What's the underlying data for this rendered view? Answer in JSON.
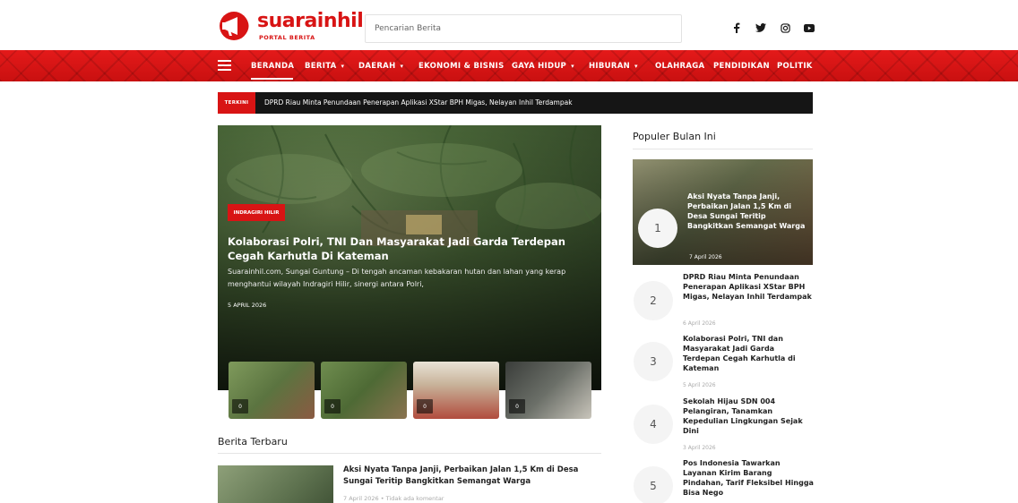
{
  "header": {
    "logo": {
      "name": "suarainhil",
      "tagline": "PORTAL BERITA"
    },
    "search": {
      "placeholder": "Pencarian Berita"
    },
    "social": [
      "facebook-icon",
      "twitter-icon",
      "instagram-icon",
      "youtube-icon"
    ]
  },
  "nav": {
    "items": [
      {
        "label": "BERANDA",
        "dropdown": false,
        "active": true
      },
      {
        "label": "BERITA",
        "dropdown": true
      },
      {
        "label": "DAERAH",
        "dropdown": true
      },
      {
        "label": "EKONOMI & BISNIS",
        "dropdown": false
      },
      {
        "label": "GAYA HIDUP",
        "dropdown": true
      },
      {
        "label": "HIBURAN",
        "dropdown": true
      },
      {
        "label": "OLAHRAGA",
        "dropdown": false
      },
      {
        "label": "PENDIDIKAN",
        "dropdown": false
      },
      {
        "label": "POLITIK",
        "dropdown": false
      }
    ],
    "caret": "▾"
  },
  "ticker": {
    "label": "TERKINI",
    "text": "DPRD Riau Minta Penundaan Penerapan Aplikasi XStar BPH Migas, Nelayan Inhil Terdampak"
  },
  "hero": {
    "category": "INDRAGIRI HILIR",
    "title": "Kolaborasi Polri, TNI Dan Masyarakat Jadi Garda Terdepan Cegah Karhutla Di Kateman",
    "excerpt": "Suarainhil.com, Sungai Guntung – Di tengah ancaman kebakaran hutan dan lahan yang kerap menghantui wilayah Indragiri Hilir, sinergi antara Polri,",
    "date": "5 APRIL 2026"
  },
  "thumbs": [
    {
      "icon": "image-icon",
      "count": "0"
    },
    {
      "icon": "image-icon",
      "count": "0"
    },
    {
      "icon": "image-icon",
      "count": "0"
    },
    {
      "icon": "image-icon",
      "count": "0"
    }
  ],
  "latest": {
    "heading": "Berita Terbaru",
    "items": [
      {
        "title": "Aksi Nyata Tanpa Janji, Perbaikan Jalan 1,5 Km di Desa Sungai Teritip Bangkitkan Semangat Warga",
        "meta": "7 April 2026 • Tidak ada komentar"
      }
    ]
  },
  "popular": {
    "heading": "Populer Bulan Ini",
    "items": [
      {
        "rank": "1",
        "title": "Aksi Nyata Tanpa Janji, Perbaikan Jalan 1,5 Km di Desa Sungai Teritip Bangkitkan Semangat Warga",
        "date": "7 April 2026"
      },
      {
        "rank": "2",
        "title": "DPRD Riau Minta Penundaan Penerapan Aplikasi XStar BPH Migas, Nelayan Inhil Terdampak",
        "date": "6 April 2026"
      },
      {
        "rank": "3",
        "title": "Kolaborasi Polri, TNI dan Masyarakat Jadi Garda Terdepan Cegah Karhutla di Kateman",
        "date": "5 April 2026"
      },
      {
        "rank": "4",
        "title": "Sekolah Hijau SDN 004 Pelangiran, Tanamkan Kepedulian Lingkungan Sejak Dini",
        "date": "3 April 2026"
      },
      {
        "rank": "5",
        "title": "Pos Indonesia Tawarkan Layanan Kirim Barang Pindahan, Tarif Fleksibel Hingga Bisa Nego",
        "date": ""
      }
    ]
  },
  "colors": {
    "brand_red": "#d81414",
    "ticker_bg": "#151515"
  }
}
